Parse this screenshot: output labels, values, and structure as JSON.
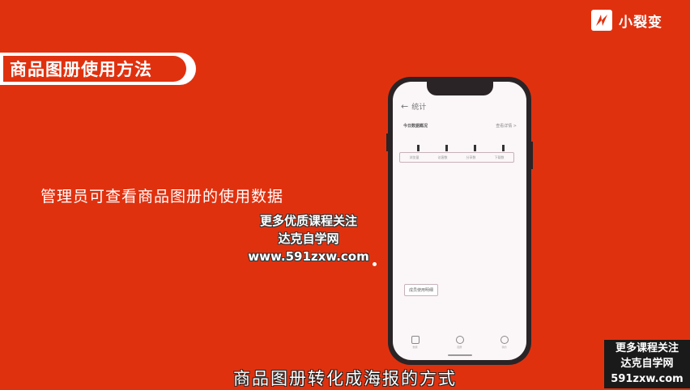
{
  "brand": {
    "name": "小裂变",
    "icon": "lightning-bolt-icon"
  },
  "section_title": "商品图册使用方法",
  "caption": "管理员可查看商品图册的使用数据",
  "watermark": {
    "line1": "更多优质课程关注",
    "line2": "达克自学网",
    "line3": "www.591zxw.com"
  },
  "phone": {
    "header_title": "统计",
    "overview_title": "今日数据概况",
    "overview_link": "查看详情 >",
    "stats": [
      {
        "label": "浏览量"
      },
      {
        "label": "访客数"
      },
      {
        "label": "分享数"
      },
      {
        "label": "下载数"
      }
    ],
    "member_button": "成员使用明细",
    "tabs": [
      {
        "label": "数据",
        "icon": "chart-icon"
      },
      {
        "label": "图册",
        "icon": "album-icon"
      },
      {
        "label": "我的",
        "icon": "user-icon"
      }
    ]
  },
  "subtitle": "商品图册转化成海报的方式",
  "corner": {
    "line1": "更多课程关注",
    "line2": "达克自学网",
    "line3": "591zxw.com"
  }
}
